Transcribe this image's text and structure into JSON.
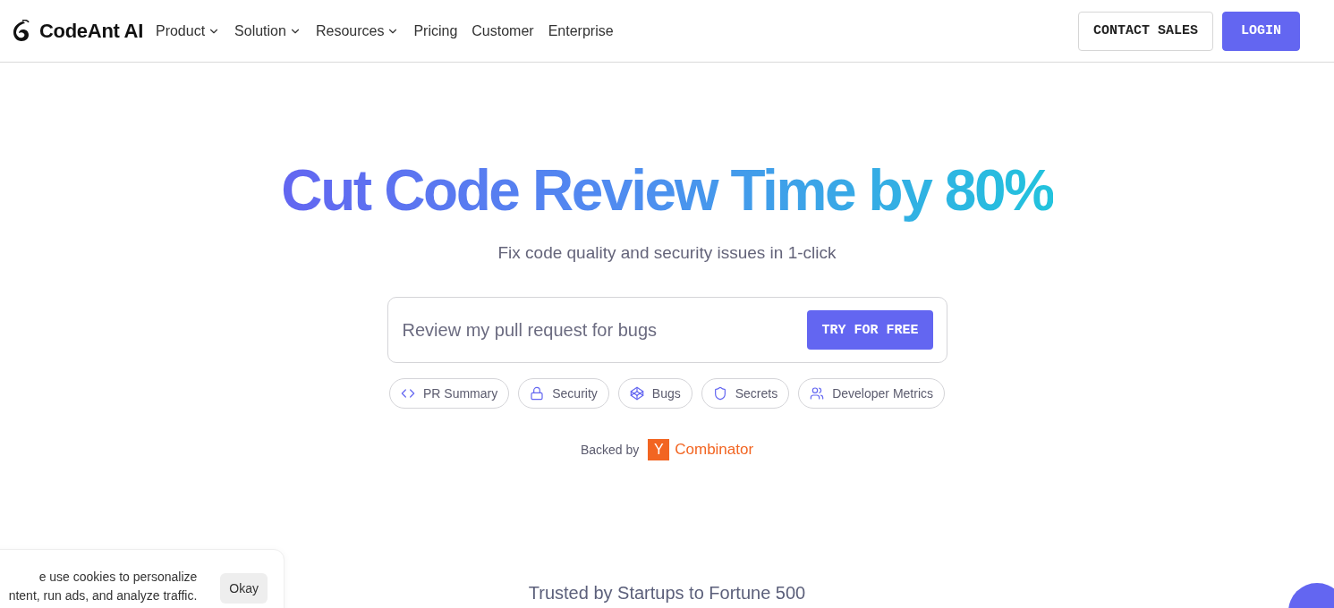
{
  "header": {
    "brand": "CodeAnt AI",
    "nav": [
      {
        "label": "Product",
        "has_menu": true
      },
      {
        "label": "Solution",
        "has_menu": true
      },
      {
        "label": "Resources",
        "has_menu": true
      },
      {
        "label": "Pricing",
        "has_menu": false
      },
      {
        "label": "Customer",
        "has_menu": false
      },
      {
        "label": "Enterprise",
        "has_menu": false
      }
    ],
    "buttons": [
      {
        "label": "CONTACT SALES",
        "kind": "outline"
      },
      {
        "label": "LOGIN",
        "kind": "primary"
      }
    ]
  },
  "hero": {
    "title": "Cut Code Review Time by 80%",
    "subtitle": "Fix code quality and security issues in 1-click",
    "prompt": {
      "placeholder": "Review my pull request for bugs",
      "button": "TRY FOR FREE"
    },
    "chips": [
      {
        "label": "PR Summary"
      },
      {
        "label": "Security"
      },
      {
        "label": "Bugs"
      },
      {
        "label": "Secrets"
      },
      {
        "label": "Developer Metrics"
      }
    ],
    "backed_by": {
      "label": "Backed by",
      "badge": "Y",
      "name": "Combinator"
    }
  },
  "trusted": "Trusted by Startups to Fortune 500",
  "cookie_banner": {
    "lines": [
      "e use cookies to personalize",
      "ntent, run ads, and analyze traffic."
    ],
    "button": "Okay"
  }
}
